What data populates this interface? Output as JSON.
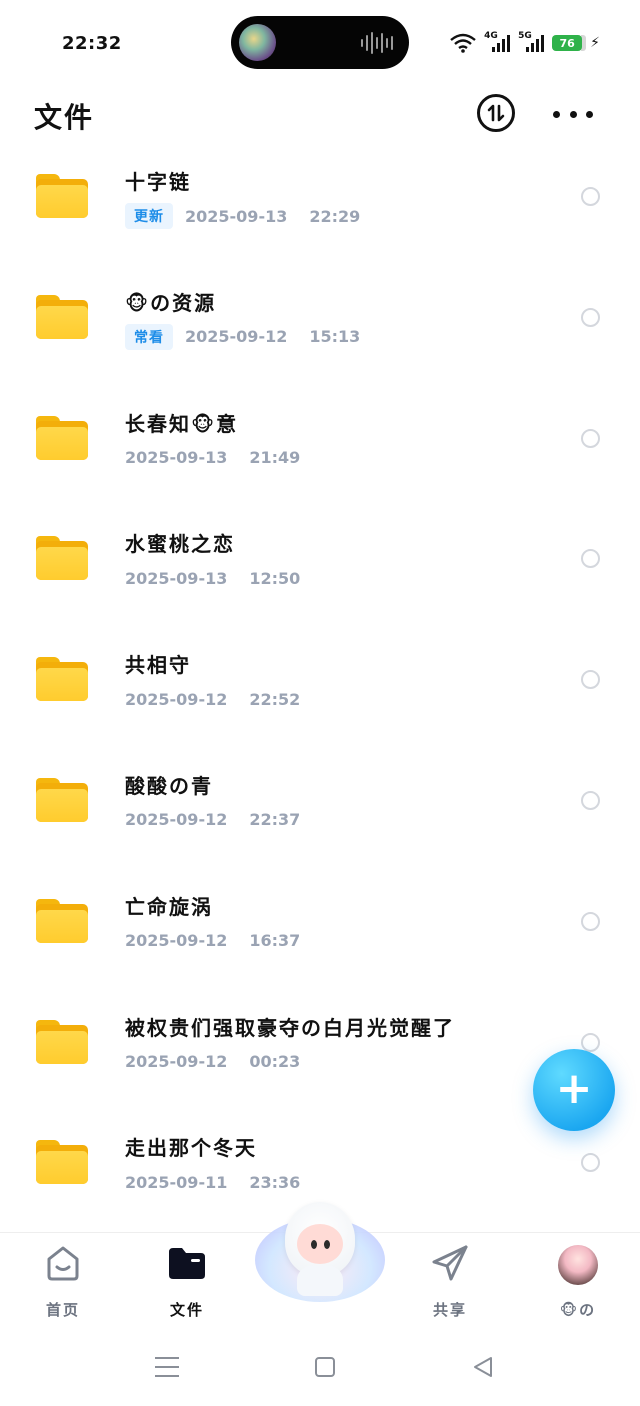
{
  "status_bar": {
    "time": "22:32",
    "network_1": "4G",
    "network_2": "5G",
    "battery": "76",
    "wifi_icon": "wifi-icon",
    "charging_icon": "charging-bolt-icon"
  },
  "header": {
    "title": "文件",
    "sort_icon": "sort-arrows-icon",
    "more_icon": "more-dots-icon"
  },
  "files": [
    {
      "name": "十字链",
      "badge": "更新",
      "date": "2025-09-13",
      "time": "22:29"
    },
    {
      "name": "🐵の资源",
      "badge": "常看",
      "date": "2025-09-12",
      "time": "15:13"
    },
    {
      "name": "长春知🐵意",
      "badge": "",
      "date": "2025-09-13",
      "time": "21:49"
    },
    {
      "name": "水蜜桃之恋",
      "badge": "",
      "date": "2025-09-13",
      "time": "12:50"
    },
    {
      "name": "共相守",
      "badge": "",
      "date": "2025-09-12",
      "time": "22:52"
    },
    {
      "name": "酸酸の青",
      "badge": "",
      "date": "2025-09-12",
      "time": "22:37"
    },
    {
      "name": "亡命旋涡",
      "badge": "",
      "date": "2025-09-12",
      "time": "16:37"
    },
    {
      "name": "被权贵们强取豪夺の白月光觉醒了",
      "badge": "",
      "date": "2025-09-12",
      "time": "00:23"
    },
    {
      "name": "走出那个冬天",
      "badge": "",
      "date": "2025-09-11",
      "time": "23:36"
    }
  ],
  "fab": {
    "label": "+"
  },
  "bottom_nav": {
    "home": "首页",
    "files": "文件",
    "share": "共享",
    "profile": "🐵の"
  },
  "colors": {
    "accent": "#1aa6f0",
    "badge_text": "#1e8de8",
    "badge_bg": "#eaf4fe",
    "folder": "#ffcc2e",
    "meta_text": "#9aa3b3",
    "battery": "#2fb24a"
  }
}
